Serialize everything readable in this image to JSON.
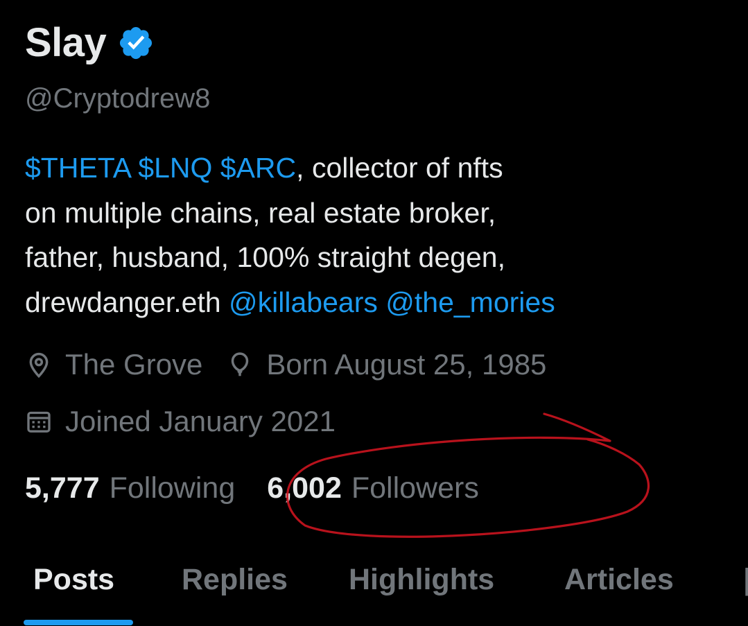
{
  "profile": {
    "name": "Slay",
    "handle": "@Cryptodrew8",
    "bio": {
      "line1_tags": "$THETA $LNQ $ARC",
      "line1_rest": ", collector of nfts",
      "line2": "on multiple chains, real estate broker,",
      "line3": "father, husband, 100% straight degen,",
      "line4_text": "drewdanger.eth ",
      "mention1": "@killabears",
      "mention2": "@the_mories"
    },
    "location": "The Grove",
    "birthday": "Born August 25, 1985",
    "joined": "Joined January 2021"
  },
  "stats": {
    "following_count": "5,777",
    "following_label": "Following",
    "followers_count": "6,002",
    "followers_label": "Followers"
  },
  "tabs": [
    "Posts",
    "Replies",
    "Highlights",
    "Articles"
  ],
  "colors": {
    "accent": "#1d9bf0",
    "annotation": "#c8141e",
    "background": "#000000",
    "text_primary": "#e7e9ea",
    "text_secondary": "#71767b"
  }
}
